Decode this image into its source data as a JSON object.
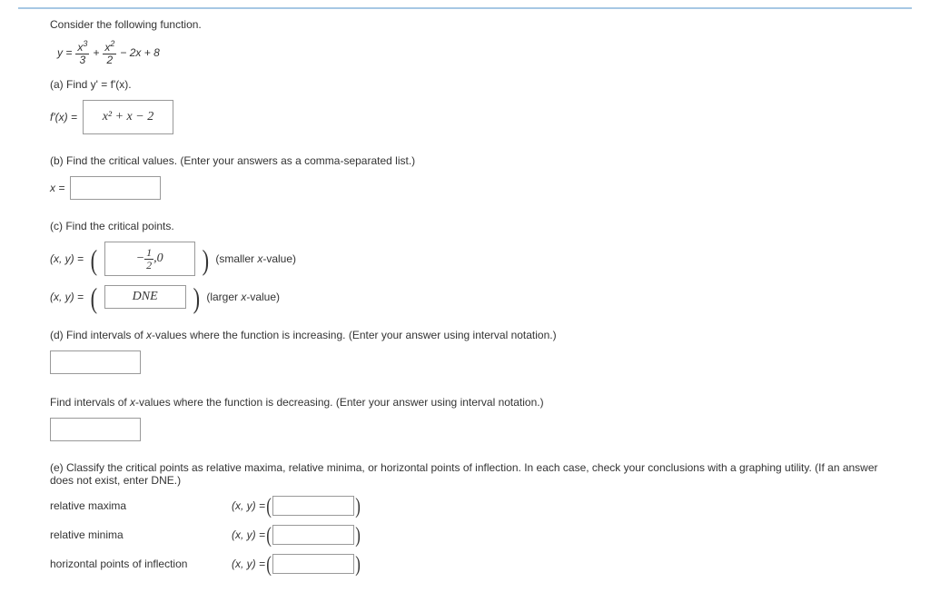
{
  "intro": "Consider the following function.",
  "equation": {
    "lhs": "y =",
    "term1_num": "x",
    "term1_sup": "3",
    "term1_den": "3",
    "plus1": "+",
    "term2_num": "x",
    "term2_sup": "2",
    "term2_den": "2",
    "rest": "− 2x + 8"
  },
  "partA": {
    "prompt": "(a) Find  y' = f'(x).",
    "lhs": "f'(x) =",
    "answer": "x² + x − 2"
  },
  "partB": {
    "prompt": "(b) Find the critical values. (Enter your answers as a comma-separated list.)",
    "lhs": "x ="
  },
  "partC": {
    "prompt": "(c) Find the critical points.",
    "row1": {
      "lhs": "(x, y)  =",
      "frac_num": "1",
      "frac_den": "2",
      "prefix": "−",
      "suffix": ",0",
      "hint": "(smaller x-value)"
    },
    "row2": {
      "lhs": "(x, y)  =",
      "value": "DNE",
      "hint": "(larger x-value)"
    }
  },
  "partD": {
    "prompt": "(d) Find intervals of x-values where the function is increasing. (Enter your answer using interval notation.)",
    "prompt2": "Find intervals of x-values where the function is decreasing. (Enter your answer using interval notation.)"
  },
  "partE": {
    "prompt": "(e) Classify the critical points as relative maxima, relative minima, or horizontal points of inflection. In each case, check your conclusions with a graphing utility. (If an answer does not exist, enter DNE.)",
    "rows": [
      {
        "label": "relative maxima",
        "lhs": "(x, y)  ="
      },
      {
        "label": "relative minima",
        "lhs": "(x, y)  ="
      },
      {
        "label": "horizontal points of inflection",
        "lhs": "(x, y)  ="
      }
    ]
  }
}
